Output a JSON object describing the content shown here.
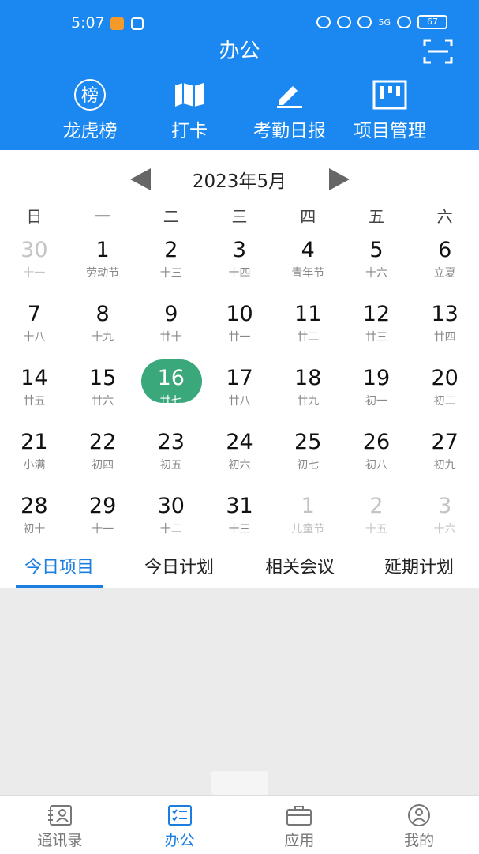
{
  "status_bar": {
    "time": "5:07",
    "battery": "67",
    "network": "5G"
  },
  "header": {
    "title": "办公"
  },
  "quick_actions": [
    {
      "label": "龙虎榜",
      "icon": "ranking-badge-icon",
      "glyph": "榜"
    },
    {
      "label": "打卡",
      "icon": "map-icon"
    },
    {
      "label": "考勤日报",
      "icon": "edit-icon"
    },
    {
      "label": "项目管理",
      "icon": "kanban-icon"
    }
  ],
  "calendar": {
    "month_label": "2023年5月",
    "weekdays": [
      "日",
      "一",
      "二",
      "三",
      "四",
      "五",
      "六"
    ],
    "weeks": [
      [
        {
          "d": "30",
          "l": "十一",
          "o": true
        },
        {
          "d": "1",
          "l": "劳动节"
        },
        {
          "d": "2",
          "l": "十三"
        },
        {
          "d": "3",
          "l": "十四"
        },
        {
          "d": "4",
          "l": "青年节"
        },
        {
          "d": "5",
          "l": "十六"
        },
        {
          "d": "6",
          "l": "立夏"
        }
      ],
      [
        {
          "d": "7",
          "l": "十八"
        },
        {
          "d": "8",
          "l": "十九"
        },
        {
          "d": "9",
          "l": "廿十"
        },
        {
          "d": "10",
          "l": "廿一"
        },
        {
          "d": "11",
          "l": "廿二"
        },
        {
          "d": "12",
          "l": "廿三"
        },
        {
          "d": "13",
          "l": "廿四"
        }
      ],
      [
        {
          "d": "14",
          "l": "廿五"
        },
        {
          "d": "15",
          "l": "廿六"
        },
        {
          "d": "16",
          "l": "廿七",
          "t": true
        },
        {
          "d": "17",
          "l": "廿八"
        },
        {
          "d": "18",
          "l": "廿九"
        },
        {
          "d": "19",
          "l": "初一"
        },
        {
          "d": "20",
          "l": "初二"
        }
      ],
      [
        {
          "d": "21",
          "l": "小满"
        },
        {
          "d": "22",
          "l": "初四"
        },
        {
          "d": "23",
          "l": "初五"
        },
        {
          "d": "24",
          "l": "初六"
        },
        {
          "d": "25",
          "l": "初七"
        },
        {
          "d": "26",
          "l": "初八"
        },
        {
          "d": "27",
          "l": "初九"
        }
      ],
      [
        {
          "d": "28",
          "l": "初十"
        },
        {
          "d": "29",
          "l": "十一"
        },
        {
          "d": "30",
          "l": "十二"
        },
        {
          "d": "31",
          "l": "十三"
        },
        {
          "d": "1",
          "l": "儿童节",
          "o": true
        },
        {
          "d": "2",
          "l": "十五",
          "o": true
        },
        {
          "d": "3",
          "l": "十六",
          "o": true
        }
      ]
    ]
  },
  "tabs": [
    {
      "label": "今日项目",
      "active": true
    },
    {
      "label": "今日计划"
    },
    {
      "label": "相关会议"
    },
    {
      "label": "延期计划"
    }
  ],
  "bottom_nav": [
    {
      "label": "通讯录",
      "icon": "contacts-icon"
    },
    {
      "label": "办公",
      "icon": "office-checklist-icon",
      "active": true
    },
    {
      "label": "应用",
      "icon": "briefcase-icon"
    },
    {
      "label": "我的",
      "icon": "profile-icon"
    }
  ],
  "colors": {
    "primary": "#1a88f0",
    "accent": "#1a7de0",
    "today": "#3aa87a"
  }
}
